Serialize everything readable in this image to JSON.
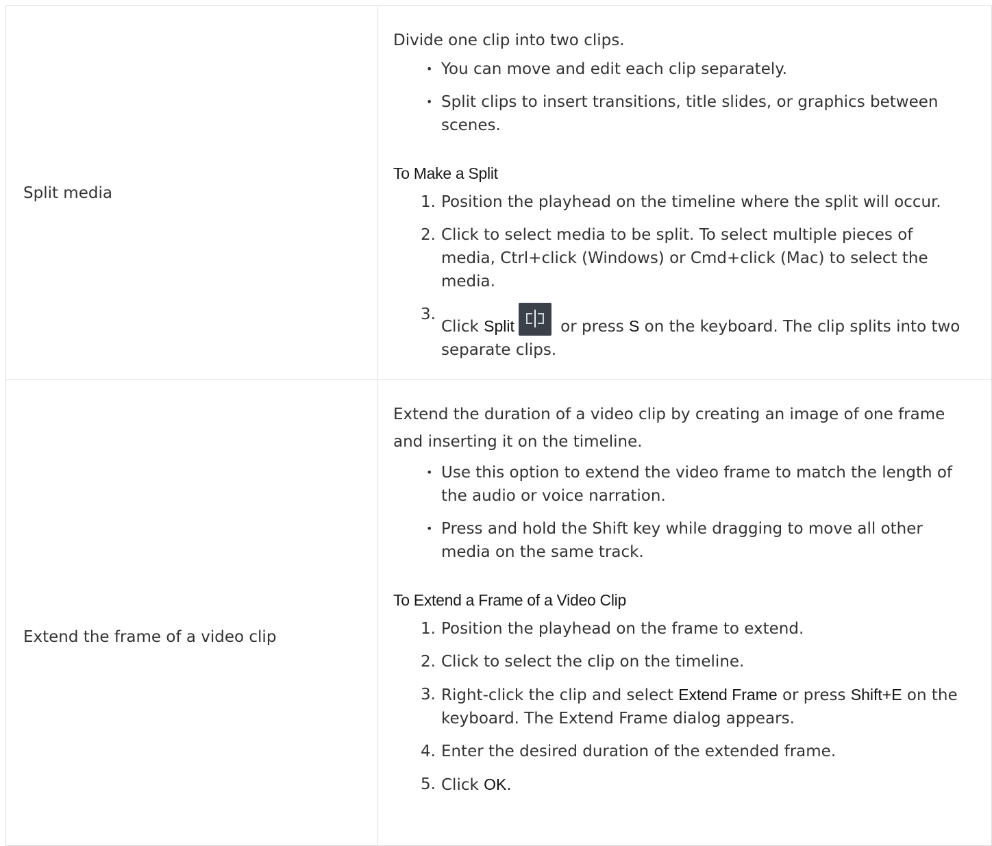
{
  "rows": [
    {
      "feature": "Split media",
      "description": "Divide one clip into two clips.",
      "bullets": [
        "You can move and edit each clip separately.",
        "Split clips to insert transitions, title slides, or graphics between scenes."
      ],
      "heading": "To Make a Split",
      "steps": {
        "s1_num": "1.",
        "s1": "Position the playhead on the timeline where the split will occur.",
        "s2_num": "2.",
        "s2": "Click to select media to be split. To select multiple pieces of media, Ctrl+click (Windows) or Cmd+click (Mac) to select the media.",
        "s3_num": "3.",
        "s3_a": "Click ",
        "s3_b": "Split",
        "s3_c": " or press ",
        "s3_d": "S",
        "s3_e": " on the keyboard. The clip splits into two separate clips."
      }
    },
    {
      "feature": "Extend the frame of a video clip",
      "description": "Extend the duration of a video clip by creating an image of one frame and inserting it on the timeline.",
      "bullets": [
        "Use this option to extend the video frame to match the length of the audio or voice narration.",
        "Press and hold the Shift key while dragging to move all other media on the same track."
      ],
      "heading": "To Extend a Frame of a Video Clip",
      "steps": {
        "s1_num": "1.",
        "s1": "Position the playhead on the frame to extend.",
        "s2_num": "2.",
        "s2": "Click to select the clip on the timeline.",
        "s3_num": "3.",
        "s3_a": "Right-click the clip and select ",
        "s3_b": "Extend Frame",
        "s3_c": " or press ",
        "s3_d": "Shift+E",
        "s3_e": " on the keyboard. The Extend Frame dialog appears.",
        "s4_num": "4.",
        "s4": "Enter the desired duration of the extended frame.",
        "s5_num": "5.",
        "s5_a": "Click ",
        "s5_b": "OK",
        "s5_c": "."
      }
    }
  ],
  "icons": {
    "split": "split-icon"
  }
}
